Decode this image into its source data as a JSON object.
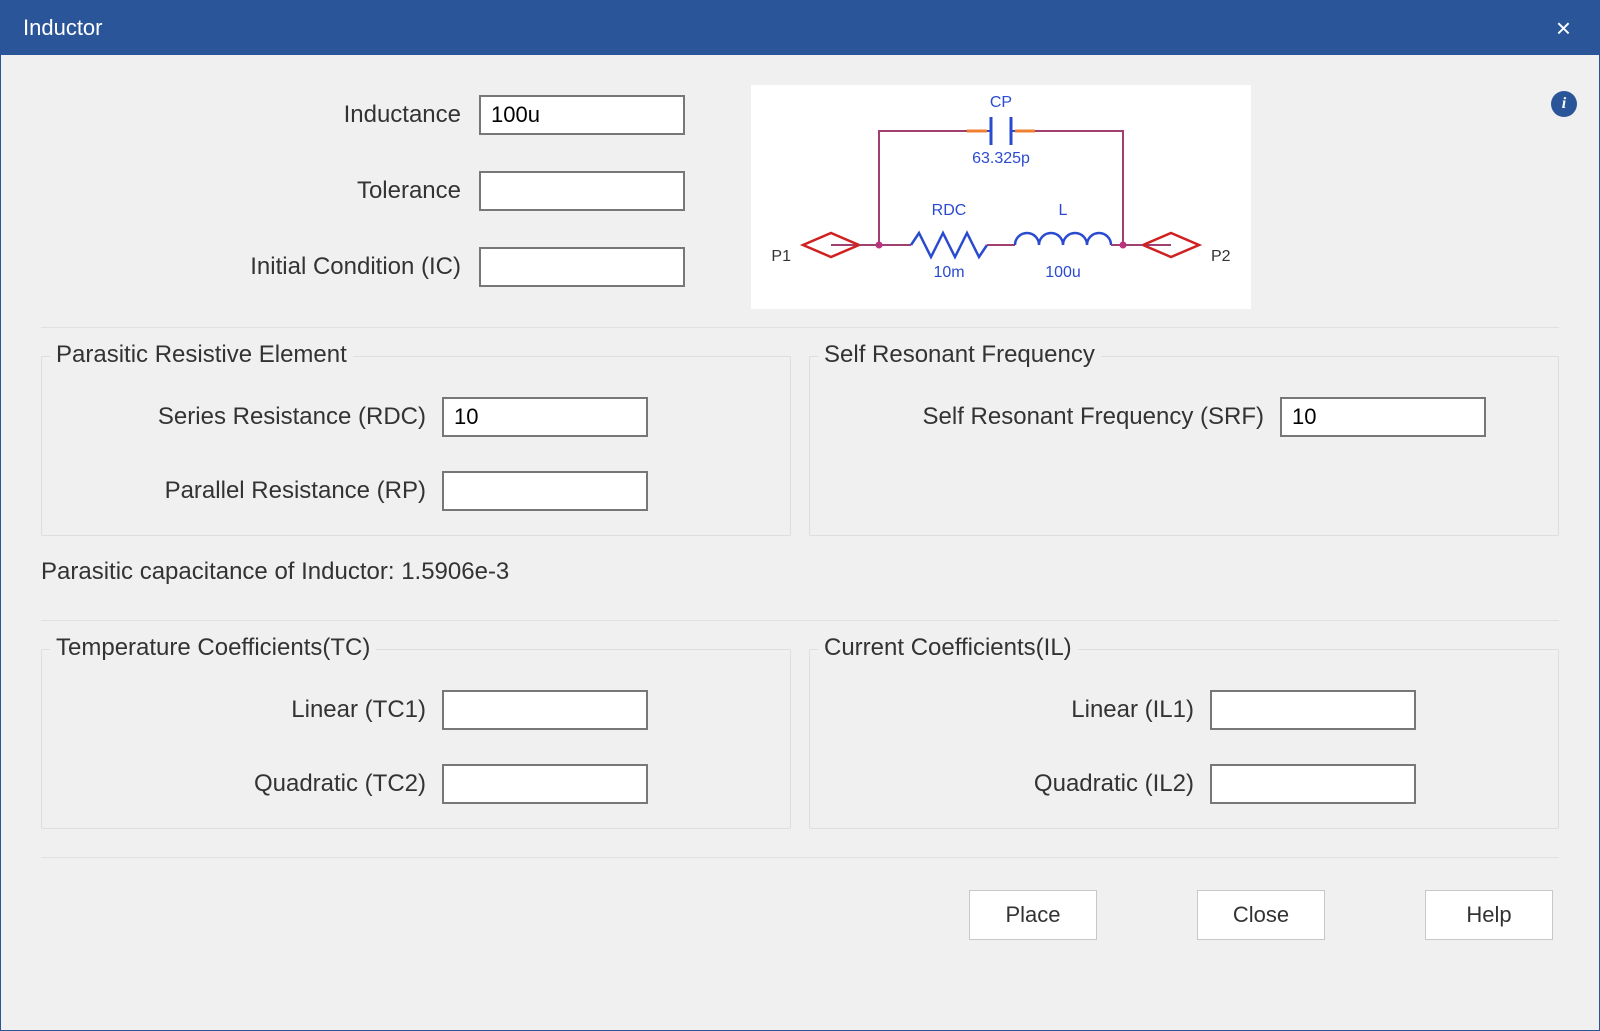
{
  "window": {
    "title": "Inductor"
  },
  "fields": {
    "inductance": {
      "label": "Inductance",
      "value": "100u"
    },
    "tolerance": {
      "label": "Tolerance",
      "value": ""
    },
    "initial_condition": {
      "label": "Initial Condition (IC)",
      "value": ""
    }
  },
  "parasitic_resistive": {
    "title": "Parasitic Resistive Element",
    "rdc": {
      "label": "Series Resistance (RDC)",
      "value": "10"
    },
    "rp": {
      "label": "Parallel Resistance (RP)",
      "value": ""
    }
  },
  "self_resonant": {
    "title": "Self Resonant Frequency",
    "srf": {
      "label": "Self Resonant Frequency (SRF)",
      "value": "10"
    }
  },
  "parasitic_capacitance_line": "Parasitic capacitance of Inductor: 1.5906e-3",
  "temp_coeff": {
    "title": "Temperature Coefficients(TC)",
    "tc1": {
      "label": "Linear (TC1)",
      "value": ""
    },
    "tc2": {
      "label": "Quadratic (TC2)",
      "value": ""
    }
  },
  "current_coeff": {
    "title": "Current Coefficients(IL)",
    "il1": {
      "label": "Linear (IL1)",
      "value": ""
    },
    "il2": {
      "label": "Quadratic (IL2)",
      "value": ""
    }
  },
  "diagram": {
    "cp_label": "CP",
    "cp_value": "63.325p",
    "rdc_label": "RDC",
    "rdc_value": "10m",
    "l_label": "L",
    "l_value": "100u",
    "p1": "P1",
    "p2": "P2"
  },
  "buttons": {
    "place": "Place",
    "close": "Close",
    "help": "Help"
  },
  "colors": {
    "accent": "#2a5699"
  }
}
